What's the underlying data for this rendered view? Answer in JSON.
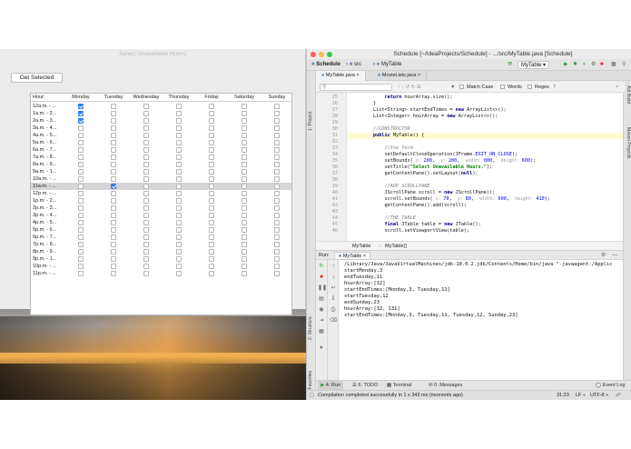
{
  "swing": {
    "title": "Select Unavailable Hours.",
    "button_label": "Get Selected",
    "columns": [
      "Hour:",
      "Monday",
      "Tuesday",
      "Wednesday",
      "Thursday",
      "Friday",
      "Saturday",
      "Sunday"
    ],
    "selected_row": 11,
    "rows": [
      {
        "hour": "12a.m. - ...",
        "checked": [
          true,
          false,
          false,
          false,
          false,
          false,
          false
        ]
      },
      {
        "hour": "1a.m. - 2...",
        "checked": [
          true,
          false,
          false,
          false,
          false,
          false,
          false
        ]
      },
      {
        "hour": "2a.m. - 3...",
        "checked": [
          true,
          false,
          false,
          false,
          false,
          false,
          false
        ]
      },
      {
        "hour": "3a.m. - 4...",
        "checked": [
          false,
          false,
          false,
          false,
          false,
          false,
          false
        ]
      },
      {
        "hour": "4a.m. - 5...",
        "checked": [
          false,
          false,
          false,
          false,
          false,
          false,
          false
        ]
      },
      {
        "hour": "5a.m. - 6...",
        "checked": [
          false,
          false,
          false,
          false,
          false,
          false,
          false
        ]
      },
      {
        "hour": "6a.m. - 7...",
        "checked": [
          false,
          false,
          false,
          false,
          false,
          false,
          false
        ]
      },
      {
        "hour": "7a.m. - 8...",
        "checked": [
          false,
          false,
          false,
          false,
          false,
          false,
          false
        ]
      },
      {
        "hour": "8a.m. - 9...",
        "checked": [
          false,
          false,
          false,
          false,
          false,
          false,
          false
        ]
      },
      {
        "hour": "9a.m. - 1...",
        "checked": [
          false,
          false,
          false,
          false,
          false,
          false,
          false
        ]
      },
      {
        "hour": "10a.m. - ...",
        "checked": [
          false,
          false,
          false,
          false,
          false,
          false,
          false
        ]
      },
      {
        "hour": "11a.m. - ...",
        "checked": [
          false,
          true,
          false,
          false,
          false,
          false,
          false
        ]
      },
      {
        "hour": "12p.m. - ...",
        "checked": [
          false,
          false,
          false,
          false,
          false,
          false,
          false
        ]
      },
      {
        "hour": "1p.m. - 2...",
        "checked": [
          false,
          false,
          false,
          false,
          false,
          false,
          false
        ]
      },
      {
        "hour": "2p.m. - 3...",
        "checked": [
          false,
          false,
          false,
          false,
          false,
          false,
          false
        ]
      },
      {
        "hour": "3p.m. - 4...",
        "checked": [
          false,
          false,
          false,
          false,
          false,
          false,
          false
        ]
      },
      {
        "hour": "4p.m. - 5...",
        "checked": [
          false,
          false,
          false,
          false,
          false,
          false,
          false
        ]
      },
      {
        "hour": "5p.m. - 6...",
        "checked": [
          false,
          false,
          false,
          false,
          false,
          false,
          false
        ]
      },
      {
        "hour": "6p.m. - 7...",
        "checked": [
          false,
          false,
          false,
          false,
          false,
          false,
          false
        ]
      },
      {
        "hour": "7p.m. - 8...",
        "checked": [
          false,
          false,
          false,
          false,
          false,
          false,
          false
        ]
      },
      {
        "hour": "8p.m. - 9...",
        "checked": [
          false,
          false,
          false,
          false,
          false,
          false,
          false
        ]
      },
      {
        "hour": "9p.m. - 1...",
        "checked": [
          false,
          false,
          false,
          false,
          false,
          false,
          false
        ]
      },
      {
        "hour": "10p.m. - ...",
        "checked": [
          false,
          false,
          false,
          false,
          false,
          false,
          false
        ]
      },
      {
        "hour": "11p.m. - ...",
        "checked": [
          false,
          false,
          false,
          false,
          false,
          false,
          false
        ]
      }
    ]
  },
  "ide": {
    "title": "Schedule [~/IdeaProjects/Schedule] - .../src/MyTable.java [Schedule]",
    "breadcrumbs": [
      "Schedule",
      "src",
      "MyTable"
    ],
    "run_config": "MyTable",
    "tabs": [
      "MyTable.java",
      "MovieLists.java"
    ],
    "find": {
      "match_case": "Match Case",
      "words": "Words",
      "regex": "Regex",
      "help": "?"
    },
    "left_strip": [
      "1: Project",
      "2: Structure",
      "2: Favorites"
    ],
    "right_strip": [
      "Ant Build",
      "Maven Projects"
    ],
    "code_lines": [
      {
        "n": "25",
        "parts": [
          [
            "            ",
            ""
          ],
          [
            "return ",
            "kw"
          ],
          [
            "hourArray.size();",
            ""
          ]
        ]
      },
      {
        "n": "26",
        "parts": [
          [
            "        }",
            ""
          ]
        ]
      },
      {
        "n": "27",
        "parts": [
          [
            "        List<String> ",
            ""
          ],
          [
            "startEndTimes",
            ""
          ],
          [
            " = ",
            ""
          ],
          [
            "new ",
            "kw"
          ],
          [
            "ArrayList<>();",
            ""
          ]
        ]
      },
      {
        "n": "28",
        "parts": [
          [
            "        List<Integer> hourArray = ",
            ""
          ],
          [
            "new ",
            "kw"
          ],
          [
            "ArrayList<>();",
            ""
          ]
        ]
      },
      {
        "n": "29",
        "parts": [
          [
            "",
            ""
          ]
        ]
      },
      {
        "n": "30",
        "parts": [
          [
            "        //CONSTRUCTOR",
            "cm"
          ]
        ]
      },
      {
        "n": "31",
        "parts": [
          [
            "        ",
            ""
          ],
          [
            "public ",
            "kw"
          ],
          [
            "MyTable() {",
            ""
          ]
        ]
      },
      {
        "n": "32",
        "parts": [
          [
            "",
            ""
          ]
        ]
      },
      {
        "n": "33",
        "parts": [
          [
            "            //the form",
            "cm"
          ]
        ]
      },
      {
        "n": "34",
        "parts": [
          [
            "            setDefaultCloseOperation(JFrame.",
            ""
          ],
          [
            "EXIT_ON_CLOSE",
            "nm"
          ],
          [
            ");",
            ""
          ]
        ]
      },
      {
        "n": "35",
        "parts": [
          [
            "            setBounds( ",
            ""
          ],
          [
            "x: ",
            "hint"
          ],
          [
            "200",
            "nm"
          ],
          [
            ",  ",
            ""
          ],
          [
            "y: ",
            "hint"
          ],
          [
            "200",
            "nm"
          ],
          [
            ",  ",
            ""
          ],
          [
            "width: ",
            "hint"
          ],
          [
            "800",
            "nm"
          ],
          [
            ",  ",
            ""
          ],
          [
            "height: ",
            "hint"
          ],
          [
            "600",
            "nm"
          ],
          [
            ");",
            ""
          ]
        ]
      },
      {
        "n": "36",
        "parts": [
          [
            "            setTitle(",
            ""
          ],
          [
            "\"Select Unavailable Hours.\"",
            "st"
          ],
          [
            ");",
            ""
          ]
        ]
      },
      {
        "n": "37",
        "parts": [
          [
            "            getContentPane().setLayout(",
            ""
          ],
          [
            "null",
            "kw"
          ],
          [
            ");",
            ""
          ]
        ]
      },
      {
        "n": "38",
        "parts": [
          [
            "",
            ""
          ]
        ]
      },
      {
        "n": "39",
        "parts": [
          [
            "            //ADD SCROLLPANE",
            "cm"
          ]
        ]
      },
      {
        "n": "40",
        "parts": [
          [
            "            JScrollPane scroll = ",
            ""
          ],
          [
            "new ",
            "kw"
          ],
          [
            "JScrollPane();",
            ""
          ]
        ]
      },
      {
        "n": "41",
        "parts": [
          [
            "            scroll.setBounds( ",
            ""
          ],
          [
            "x: ",
            "hint"
          ],
          [
            "70",
            "nm"
          ],
          [
            ",  ",
            ""
          ],
          [
            "y: ",
            "hint"
          ],
          [
            "80",
            "nm"
          ],
          [
            ",  ",
            ""
          ],
          [
            "width: ",
            "hint"
          ],
          [
            "600",
            "nm"
          ],
          [
            ",  ",
            ""
          ],
          [
            "height: ",
            "hint"
          ],
          [
            "410",
            "nm"
          ],
          [
            ");",
            ""
          ]
        ]
      },
      {
        "n": "42",
        "parts": [
          [
            "            getContentPane().add(scroll);",
            ""
          ]
        ]
      },
      {
        "n": "43",
        "parts": [
          [
            "",
            ""
          ]
        ]
      },
      {
        "n": "44",
        "parts": [
          [
            "            //THE TABLE",
            "cm"
          ]
        ]
      },
      {
        "n": "45",
        "parts": [
          [
            "            ",
            ""
          ],
          [
            "final ",
            "kw"
          ],
          [
            "JTable table = ",
            ""
          ],
          [
            "new ",
            "kw"
          ],
          [
            "JTable();",
            ""
          ]
        ]
      },
      {
        "n": "46",
        "parts": [
          [
            "            scroll.setViewportView(table);",
            ""
          ]
        ]
      }
    ],
    "editor_breadcrumb": [
      "MyTable",
      "MyTable()"
    ],
    "run_label": "Run:",
    "run_tab": "MyTable",
    "console": [
      "/Library/Java/JavaVirtualMachines/jdk-10.0.2.jdk/Contents/Home/bin/java \"-javaagent:/Applic",
      "startMonday,3",
      "endTuesday,11",
      "hourArray:[32]",
      "startEndTimes:[Monday,3, Tuesday,11]",
      "startTuesday,12",
      "endSunday,23",
      "hourArray:[32, 131]",
      "startEndTimes:[Monday,3, Tuesday,11, Tuesday,12, Sunday,23]"
    ],
    "bottom_tabs": [
      "4: Run",
      "6: TODO",
      "Terminal",
      "0: Messages"
    ],
    "event_log": "Event Log",
    "status": "Compilation completed successfully in 1 s 343 ms (moments ago)",
    "position": "31:23",
    "line_sep": "LF ÷",
    "encoding": "UTF-8 ÷"
  }
}
